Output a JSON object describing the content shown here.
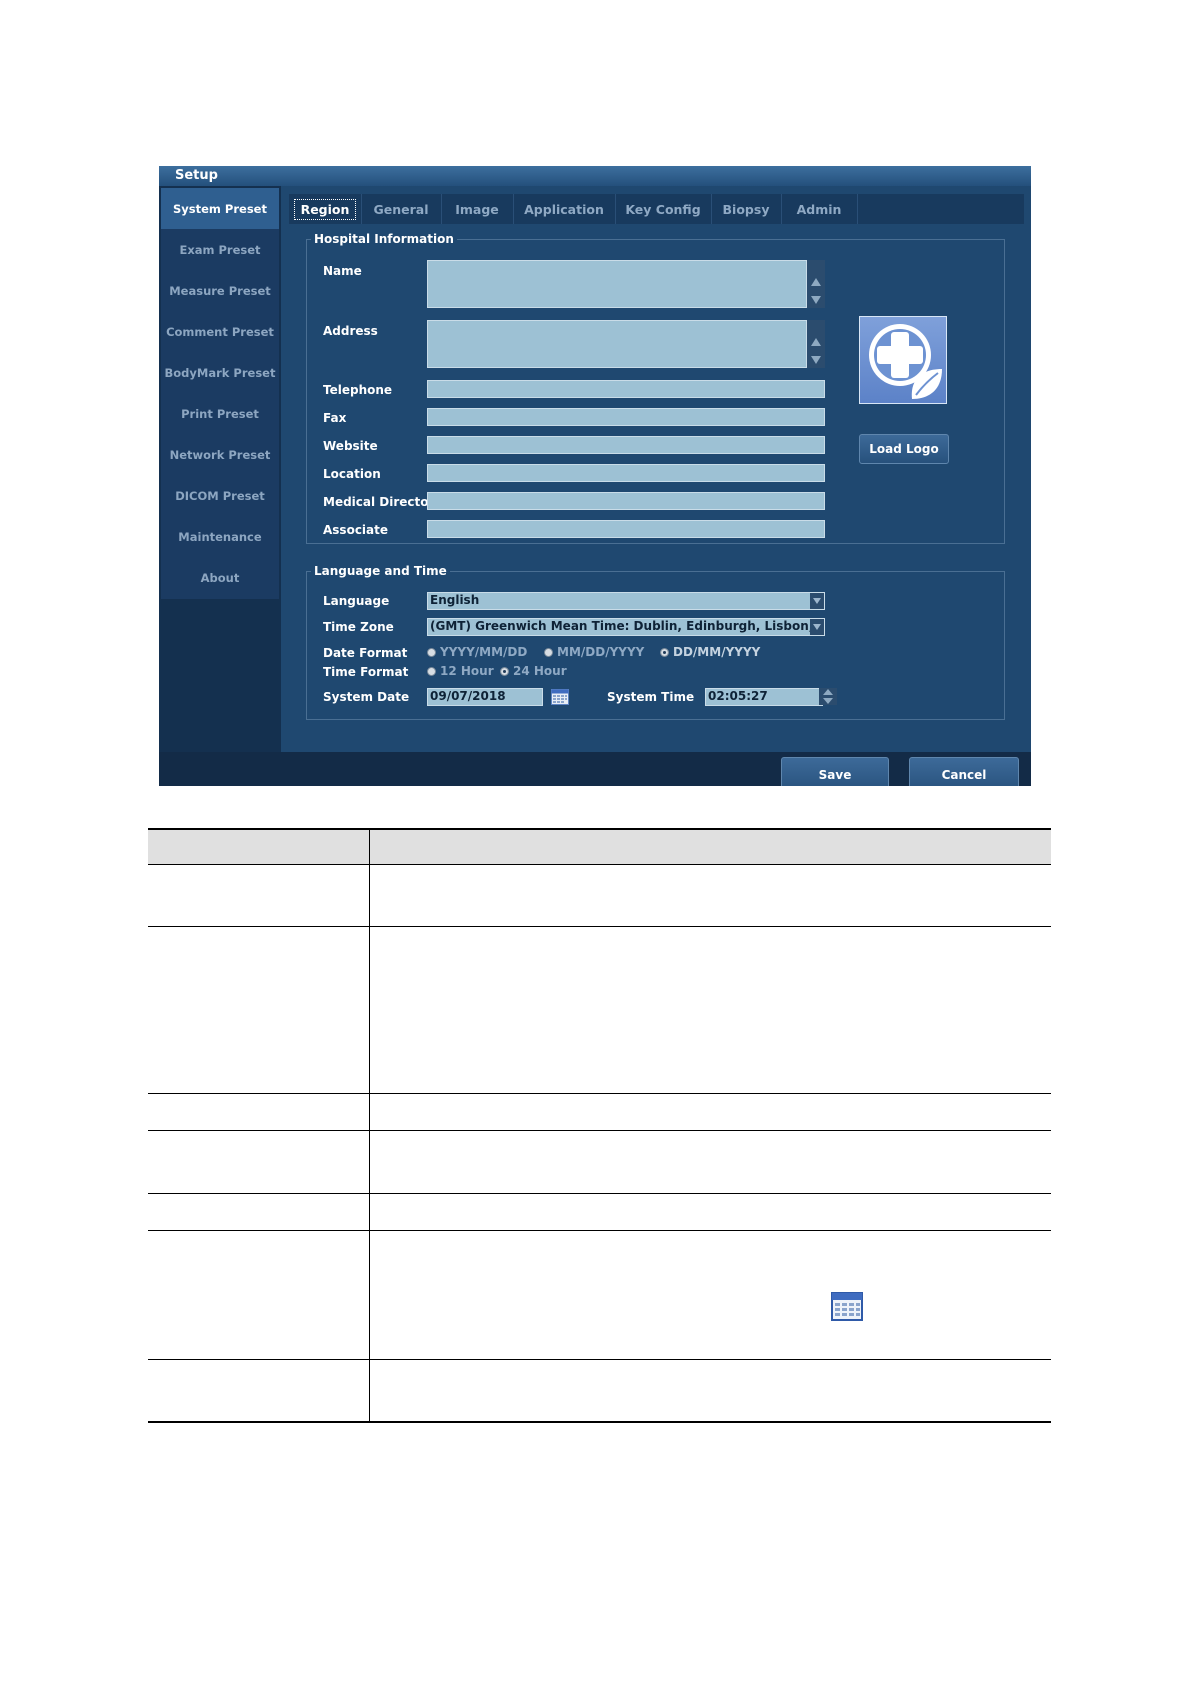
{
  "window": {
    "title": "Setup"
  },
  "sidebar": {
    "items": [
      {
        "label": "System Preset",
        "active": true
      },
      {
        "label": "Exam Preset"
      },
      {
        "label": "Measure Preset"
      },
      {
        "label": "Comment Preset"
      },
      {
        "label": "BodyMark Preset"
      },
      {
        "label": "Print Preset"
      },
      {
        "label": "Network Preset"
      },
      {
        "label": "DICOM Preset"
      },
      {
        "label": "Maintenance"
      },
      {
        "label": "About"
      }
    ]
  },
  "tabs": [
    {
      "label": "Region",
      "active": true
    },
    {
      "label": "General"
    },
    {
      "label": "Image"
    },
    {
      "label": "Application"
    },
    {
      "label": "Key Config"
    },
    {
      "label": "Biopsy"
    },
    {
      "label": "Admin"
    }
  ],
  "hospital": {
    "legend": "Hospital Information",
    "name_label": "Name",
    "address_label": "Address",
    "telephone_label": "Telephone",
    "fax_label": "Fax",
    "website_label": "Website",
    "location_label": "Location",
    "medical_director_label": "Medical Director",
    "associate_label": "Associate",
    "load_logo_label": "Load Logo"
  },
  "language_time": {
    "legend": "Language and Time",
    "language_label": "Language",
    "language_value": "English",
    "timezone_label": "Time Zone",
    "timezone_value": "(GMT) Greenwich Mean Time: Dublin, Edinburgh, Lisbon, London",
    "date_format_label": "Date Format",
    "date_formats": [
      "YYYY/MM/DD",
      "MM/DD/YYYY",
      "DD/MM/YYYY"
    ],
    "date_format_selected": "DD/MM/YYYY",
    "time_format_label": "Time Format",
    "time_formats": [
      "12 Hour",
      "24 Hour"
    ],
    "time_format_selected": "24 Hour",
    "system_date_label": "System Date",
    "system_date_value": "09/07/2018",
    "system_time_label": "System Time",
    "system_time_value": "02:05:27"
  },
  "footer": {
    "save_label": "Save",
    "cancel_label": "Cancel"
  },
  "icons": {
    "logo": "medical-cross-leaf-icon",
    "calendar": "calendar-icon",
    "scroll_up": "arrow-up-icon",
    "scroll_down": "arrow-down-icon",
    "dropdown": "chevron-down-icon"
  },
  "colors": {
    "window_bg": "#14304f",
    "panel_bg": "#1f4870",
    "field_bg": "#9dc1d4",
    "active_side": "#2f5f90"
  }
}
